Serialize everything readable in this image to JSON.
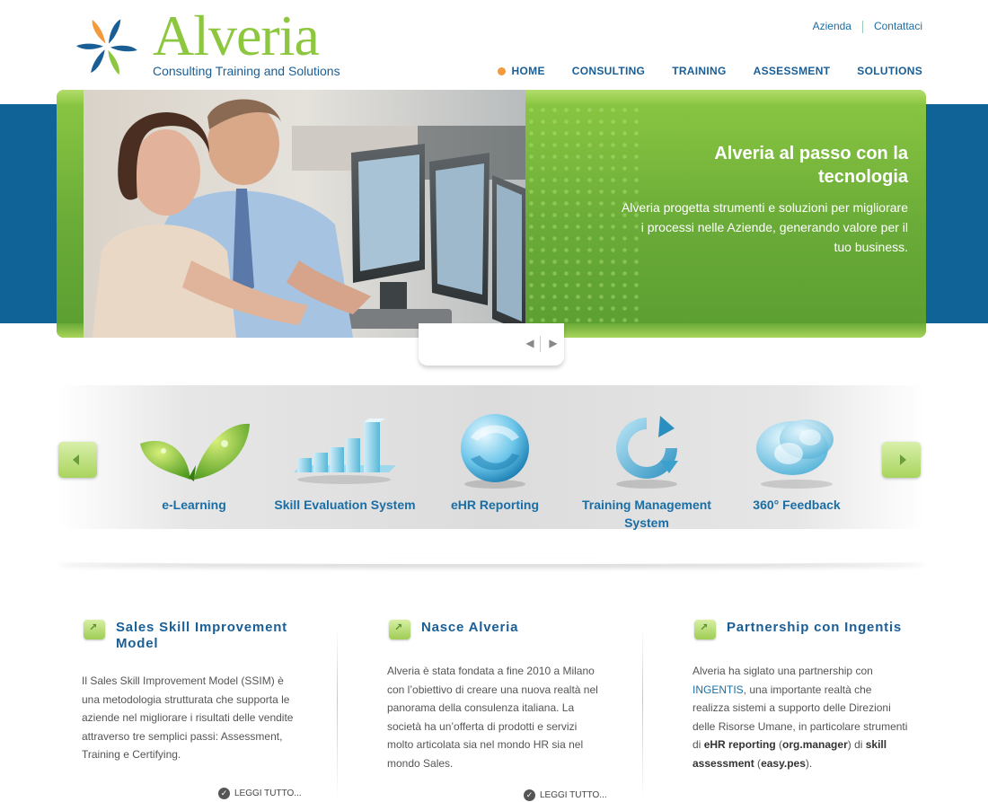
{
  "brand": {
    "name": "Alveria",
    "tagline": "Consulting Training and Solutions",
    "colors": {
      "green": "#8dc63f",
      "blue": "#1a5e96",
      "accent": "#f39a3c",
      "band": "#0f6396"
    }
  },
  "top_links": [
    "Azienda",
    "Contattaci"
  ],
  "nav": {
    "active": "HOME",
    "items": [
      "HOME",
      "CONSULTING",
      "TRAINING",
      "ASSESSMENT",
      "SOLUTIONS"
    ]
  },
  "hero": {
    "title": "Alveria al passo con la tecnologia",
    "description": "Alveria progetta strumenti e soluzioni per migliorare i processi nelle Aziende, generando valore per il tuo business.",
    "prev_icon": "chevron-left-icon",
    "next_icon": "chevron-right-icon"
  },
  "carousel": {
    "items": [
      {
        "label": "e-Learning",
        "icon": "leaf-icon"
      },
      {
        "label": "Skill Evaluation System",
        "icon": "bar-chart-icon"
      },
      {
        "label": "eHR Reporting",
        "icon": "globe-icon"
      },
      {
        "label": "Training Management System",
        "icon": "cycle-icon"
      },
      {
        "label": "360° Feedback",
        "icon": "feedback-icon"
      }
    ]
  },
  "news": [
    {
      "title": "Sales Skill Improvement Model",
      "body": "Il Sales Skill Improvement Model (SSIM) è una metodologia strutturata che supporta le aziende nel migliorare i risultati delle vendite attraverso tre semplici passi: Assessment, Training e Certifying.",
      "more": "LEGGI TUTTO..."
    },
    {
      "title": "Nasce Alveria",
      "body": "Alveria è stata fondata a fine 2010 a Milano con l’obiettivo di creare una nuova realtà nel panorama della consulenza italiana. La società ha un’offerta di prodotti e servizi molto articolata sia nel mondo HR sia nel mondo Sales.",
      "more": "LEGGI TUTTO..."
    },
    {
      "title": "Partnership con Ingentis",
      "body_parts": {
        "p1": "Alveria ha siglato una partnership con ",
        "link": "INGENTIS",
        "p2": ", una importante realtà che realizza sistemi a supporto delle Direzioni delle Risorse Umane, in particolare strumenti di ",
        "b1": "eHR reporting",
        "p3": " (",
        "b2": "org.manager",
        "p4": ") di ",
        "b3": "skill assessment",
        "p5": " (",
        "b4": "easy.pes",
        "p6": ")."
      }
    }
  ]
}
